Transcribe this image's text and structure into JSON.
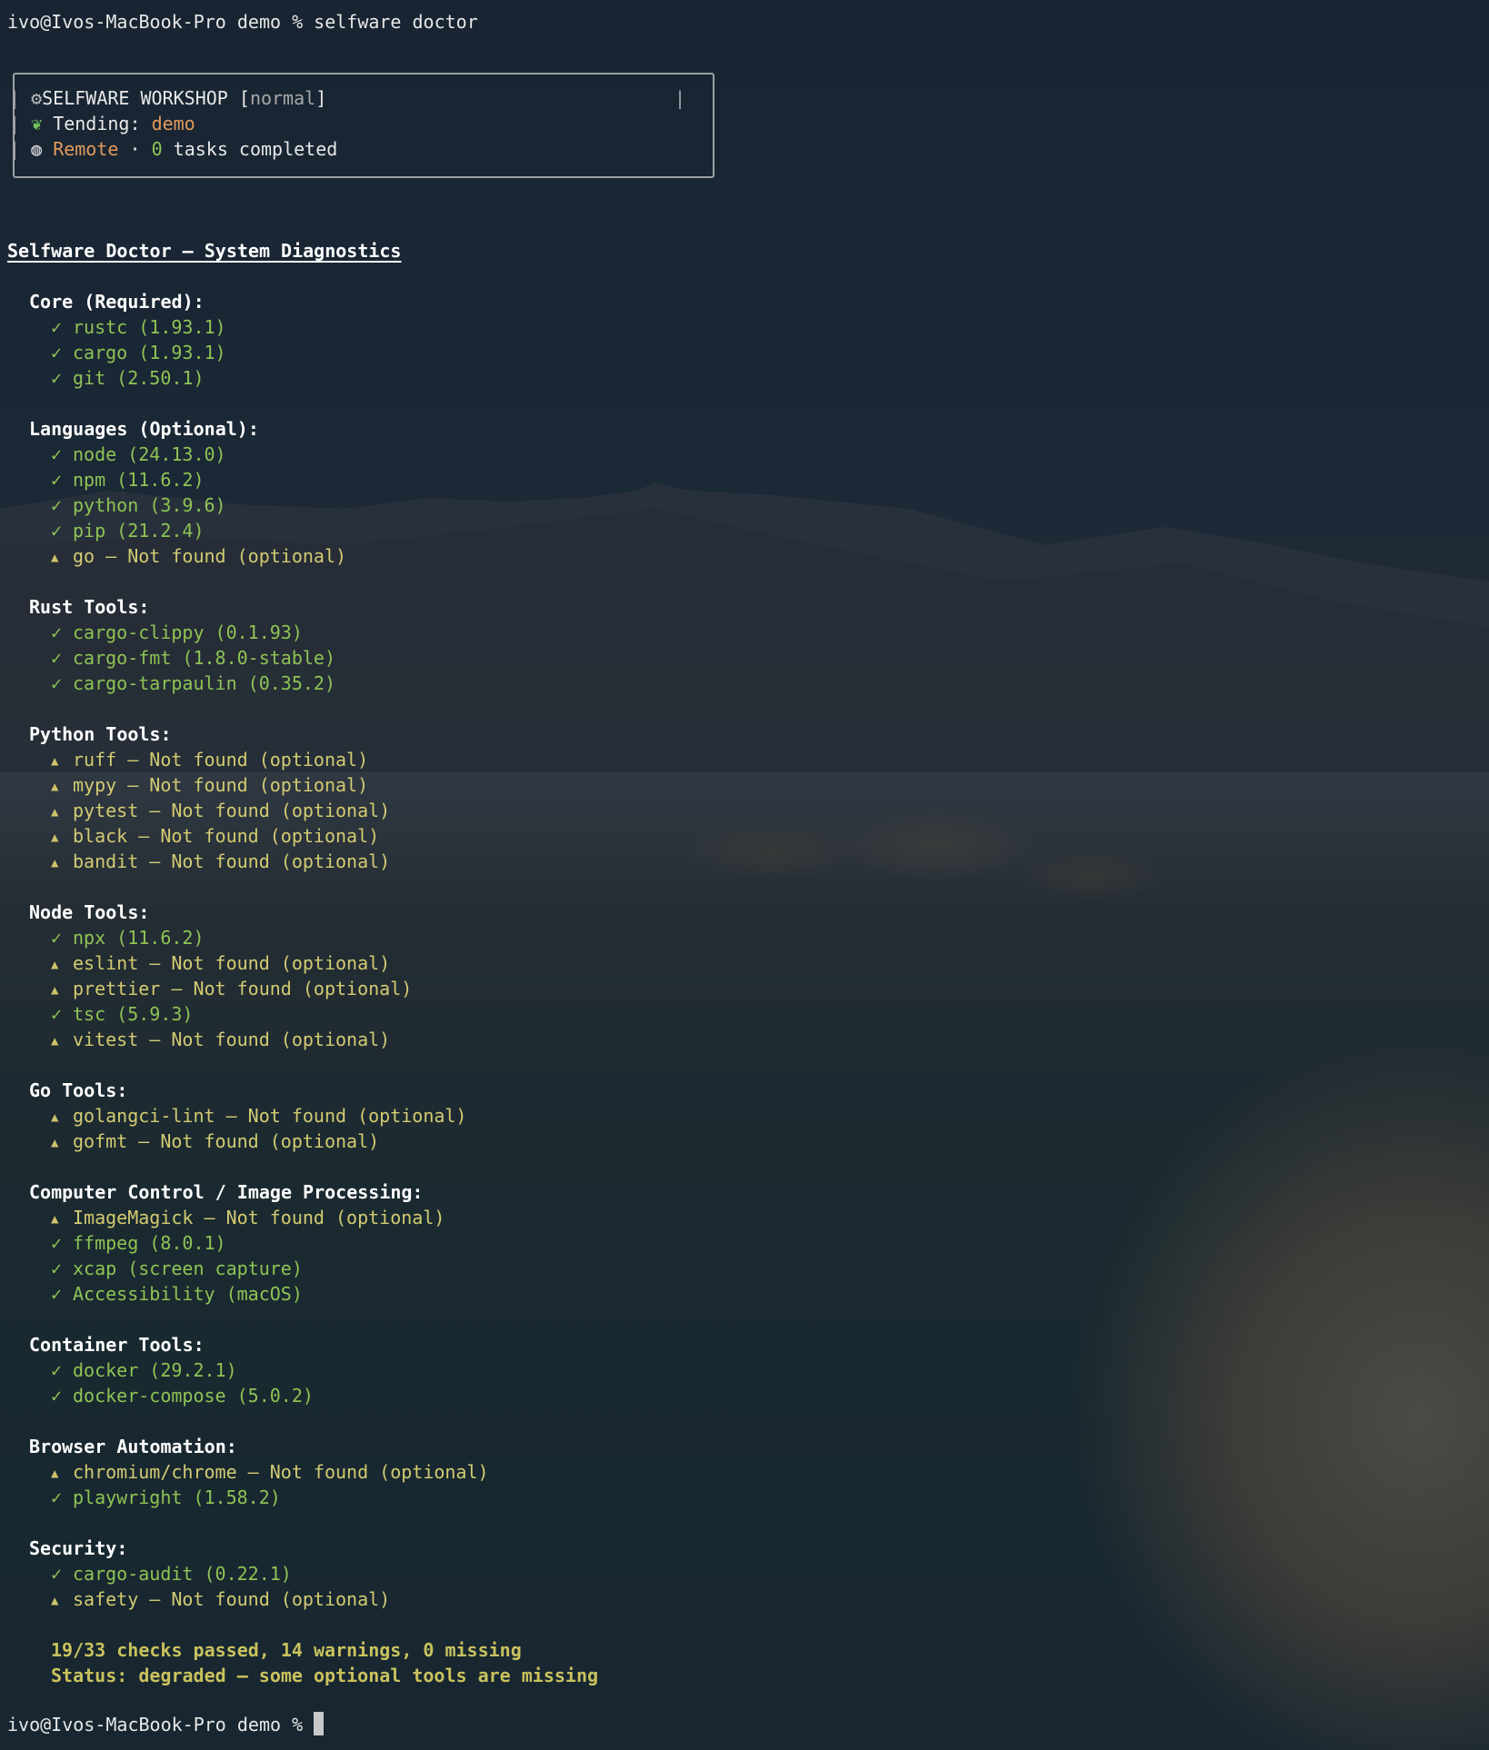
{
  "prompt_line": "ivo@Ivos-MacBook-Pro demo % selfware doctor",
  "banner": {
    "title": "SELFWARE WORKSHOP",
    "mode_open": "[",
    "mode": "normal",
    "mode_close": "]",
    "tending_label": "Tending:",
    "tending_value": "demo",
    "remote": "Remote",
    "dot": "·",
    "tasks_count": "0",
    "tasks_text": "tasks completed"
  },
  "title": "Selfware Doctor — System Diagnostics",
  "sections": [
    {
      "header": "Core (Required):",
      "items": [
        {
          "status": "ok",
          "text": "rustc (1.93.1)"
        },
        {
          "status": "ok",
          "text": "cargo (1.93.1)"
        },
        {
          "status": "ok",
          "text": "git (2.50.1)"
        }
      ]
    },
    {
      "header": "Languages (Optional):",
      "items": [
        {
          "status": "ok",
          "text": "node (24.13.0)"
        },
        {
          "status": "ok",
          "text": "npm (11.6.2)"
        },
        {
          "status": "ok",
          "text": "python (3.9.6)"
        },
        {
          "status": "ok",
          "text": "pip (21.2.4)"
        },
        {
          "status": "warn",
          "text": "go — Not found (optional)"
        }
      ]
    },
    {
      "header": "Rust Tools:",
      "items": [
        {
          "status": "ok",
          "text": "cargo-clippy (0.1.93)"
        },
        {
          "status": "ok",
          "text": "cargo-fmt (1.8.0-stable)"
        },
        {
          "status": "ok",
          "text": "cargo-tarpaulin (0.35.2)"
        }
      ]
    },
    {
      "header": "Python Tools:",
      "items": [
        {
          "status": "warn",
          "text": "ruff — Not found (optional)"
        },
        {
          "status": "warn",
          "text": "mypy — Not found (optional)"
        },
        {
          "status": "warn",
          "text": "pytest — Not found (optional)"
        },
        {
          "status": "warn",
          "text": "black — Not found (optional)"
        },
        {
          "status": "warn",
          "text": "bandit — Not found (optional)"
        }
      ]
    },
    {
      "header": "Node Tools:",
      "items": [
        {
          "status": "ok",
          "text": "npx (11.6.2)"
        },
        {
          "status": "warn",
          "text": "eslint — Not found (optional)"
        },
        {
          "status": "warn",
          "text": "prettier — Not found (optional)"
        },
        {
          "status": "ok",
          "text": "tsc (5.9.3)"
        },
        {
          "status": "warn",
          "text": "vitest — Not found (optional)"
        }
      ]
    },
    {
      "header": "Go Tools:",
      "items": [
        {
          "status": "warn",
          "text": "golangci-lint — Not found (optional)"
        },
        {
          "status": "warn",
          "text": "gofmt — Not found (optional)"
        }
      ]
    },
    {
      "header": "Computer Control / Image Processing:",
      "items": [
        {
          "status": "warn",
          "text": "ImageMagick — Not found (optional)"
        },
        {
          "status": "ok",
          "text": "ffmpeg (8.0.1)"
        },
        {
          "status": "ok",
          "text": "xcap (screen capture)"
        },
        {
          "status": "ok",
          "text": "Accessibility (macOS)"
        }
      ]
    },
    {
      "header": "Container Tools:",
      "items": [
        {
          "status": "ok",
          "text": "docker (29.2.1)"
        },
        {
          "status": "ok",
          "text": "docker-compose (5.0.2)"
        }
      ]
    },
    {
      "header": "Browser Automation:",
      "items": [
        {
          "status": "warn",
          "text": "chromium/chrome — Not found (optional)"
        },
        {
          "status": "ok",
          "text": "playwright (1.58.2)"
        }
      ]
    },
    {
      "header": "Security:",
      "items": [
        {
          "status": "ok",
          "text": "cargo-audit (0.22.1)"
        },
        {
          "status": "warn",
          "text": "safety — Not found (optional)"
        }
      ]
    }
  ],
  "summary": {
    "checks": "19/33 checks passed, 14 warnings, 0 missing",
    "status": "Status: degraded — some optional tools are missing"
  },
  "final_prompt": "ivo@Ivos-MacBook-Pro demo %",
  "icons": {
    "ok": "check-icon",
    "warn": "warning-triangle-icon"
  },
  "colors": {
    "ok": "#8ec355",
    "warn": "#d2cb72",
    "accent": "#e29a5e"
  }
}
